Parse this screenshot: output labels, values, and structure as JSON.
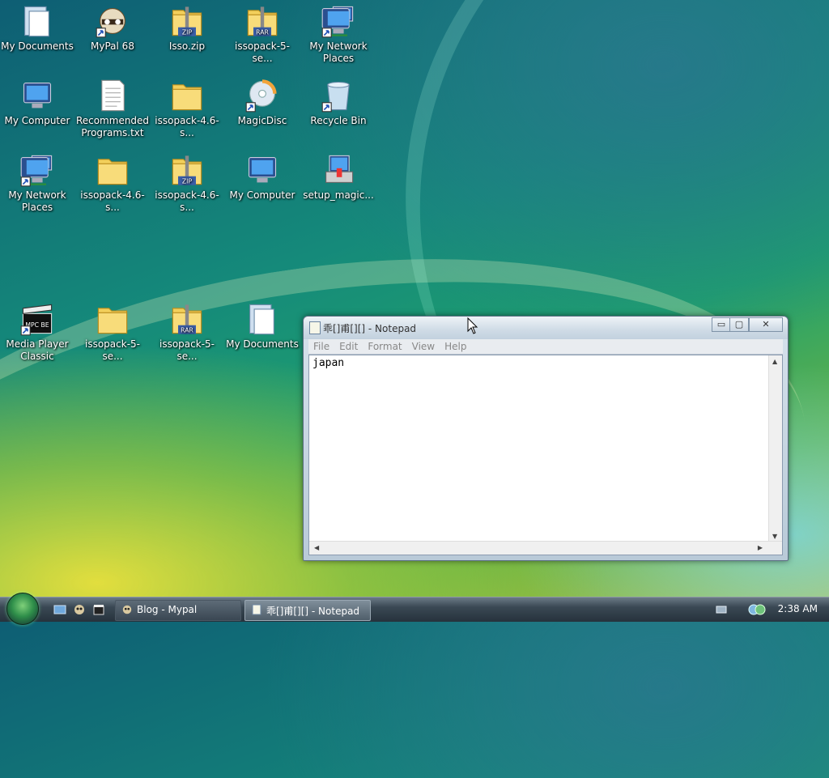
{
  "desktop": {
    "icons": [
      {
        "label": "My Documents",
        "icon": "documents-folder-icon"
      },
      {
        "label": "MyPal 68",
        "icon": "raccoon-app-icon"
      },
      {
        "label": "Isso.zip",
        "icon": "zip-folder-icon",
        "badge": "ZIP"
      },
      {
        "label": "issopack-5-se...",
        "icon": "rar-folder-icon",
        "badge": "RAR"
      },
      {
        "label": "My Network Places",
        "icon": "network-computers-icon"
      },
      {
        "label": "My Computer",
        "icon": "computer-icon"
      },
      {
        "label": "Recommended Programs.txt",
        "icon": "text-file-icon"
      },
      {
        "label": "issopack-4.6-s...",
        "icon": "folder-icon"
      },
      {
        "label": "MagicDisc",
        "icon": "magicdisc-icon"
      },
      {
        "label": "Recycle Bin",
        "icon": "recycle-bin-icon"
      },
      {
        "label": "My Network Places",
        "icon": "network-computers-icon"
      },
      {
        "label": "issopack-4.6-s...",
        "icon": "folder-icon"
      },
      {
        "label": "issopack-4.6-s...",
        "icon": "zip-folder-icon",
        "badge": "ZIP"
      },
      {
        "label": "My Computer",
        "icon": "computer-icon"
      },
      {
        "label": "setup_magic...",
        "icon": "installer-icon"
      },
      {
        "label": "Media Player Classic",
        "icon": "media-player-icon",
        "badge": "MPC BE"
      },
      {
        "label": "issopack-5-se...",
        "icon": "folder-icon"
      },
      {
        "label": "issopack-5-se...",
        "icon": "rar-folder-icon",
        "badge": "RAR"
      },
      {
        "label": "My Documents",
        "icon": "documents-folder-icon"
      }
    ]
  },
  "notepad": {
    "title": "乖[]甫[][] - Notepad",
    "controls": {
      "minimize": "▭",
      "maximize": "▢",
      "close": "✕"
    },
    "menu": [
      "File",
      "Edit",
      "Format",
      "View",
      "Help"
    ],
    "content": "japan"
  },
  "taskbar": {
    "tasks": [
      {
        "label": "Blog - Mypal",
        "icon": "raccoon-app-icon",
        "active": false
      },
      {
        "label": "乖[]甫[][] - Notepad",
        "icon": "notepad-icon",
        "active": true
      }
    ],
    "quick_launch": [
      "show-desktop-icon",
      "mypal-icon",
      "media-player-icon"
    ],
    "tray_icons": [
      "keyboard-icon",
      "network-icon"
    ],
    "clock": "2:38 AM"
  },
  "colors": {
    "folder": "#f2cf5b",
    "accent": "#1f9f6e"
  }
}
